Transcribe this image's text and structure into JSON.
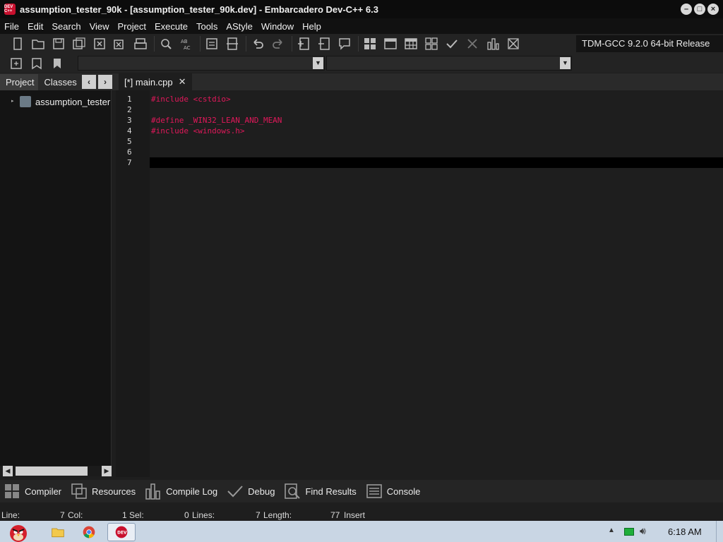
{
  "window": {
    "title": "assumption_tester_90k - [assumption_tester_90k.dev] - Embarcadero Dev-C++ 6.3",
    "icon_text": "DEV C++"
  },
  "menu": [
    "File",
    "Edit",
    "Search",
    "View",
    "Project",
    "Execute",
    "Tools",
    "AStyle",
    "Window",
    "Help"
  ],
  "toolbar": {
    "compiler": "TDM-GCC 9.2.0 64-bit Release"
  },
  "left_panel": {
    "tabs": [
      "Project",
      "Classes"
    ],
    "prev_arrow": "‹",
    "next_arrow": "›",
    "tree_item": "assumption_tester"
  },
  "editor": {
    "tab_label": "[*] main.cpp",
    "tab_close": "✕",
    "lines": [
      {
        "num": "1",
        "code": "#include <cstdio>"
      },
      {
        "num": "2",
        "code": ""
      },
      {
        "num": "3",
        "code": "#define _WIN32_LEAN_AND_MEAN"
      },
      {
        "num": "4",
        "code": "#include <windows.h>"
      },
      {
        "num": "5",
        "code": ""
      },
      {
        "num": "6",
        "code": ""
      },
      {
        "num": "7",
        "code": ""
      }
    ]
  },
  "bottom_tabs": [
    "Compiler",
    "Resources",
    "Compile Log",
    "Debug",
    "Find Results",
    "Console"
  ],
  "status": {
    "line_label": "Line:",
    "line_value": "7",
    "col_label": "Col:",
    "col_value": "1",
    "sel_label": "Sel:",
    "sel_value": "0",
    "lines_label": "Lines:",
    "lines_value": "7",
    "length_label": "Length:",
    "length_value": "77",
    "mode": "Insert"
  },
  "taskbar": {
    "clock": "6:18 AM"
  },
  "colors": {
    "code_keyword": "#e0185a",
    "editor_bg": "#1e1e1e"
  }
}
